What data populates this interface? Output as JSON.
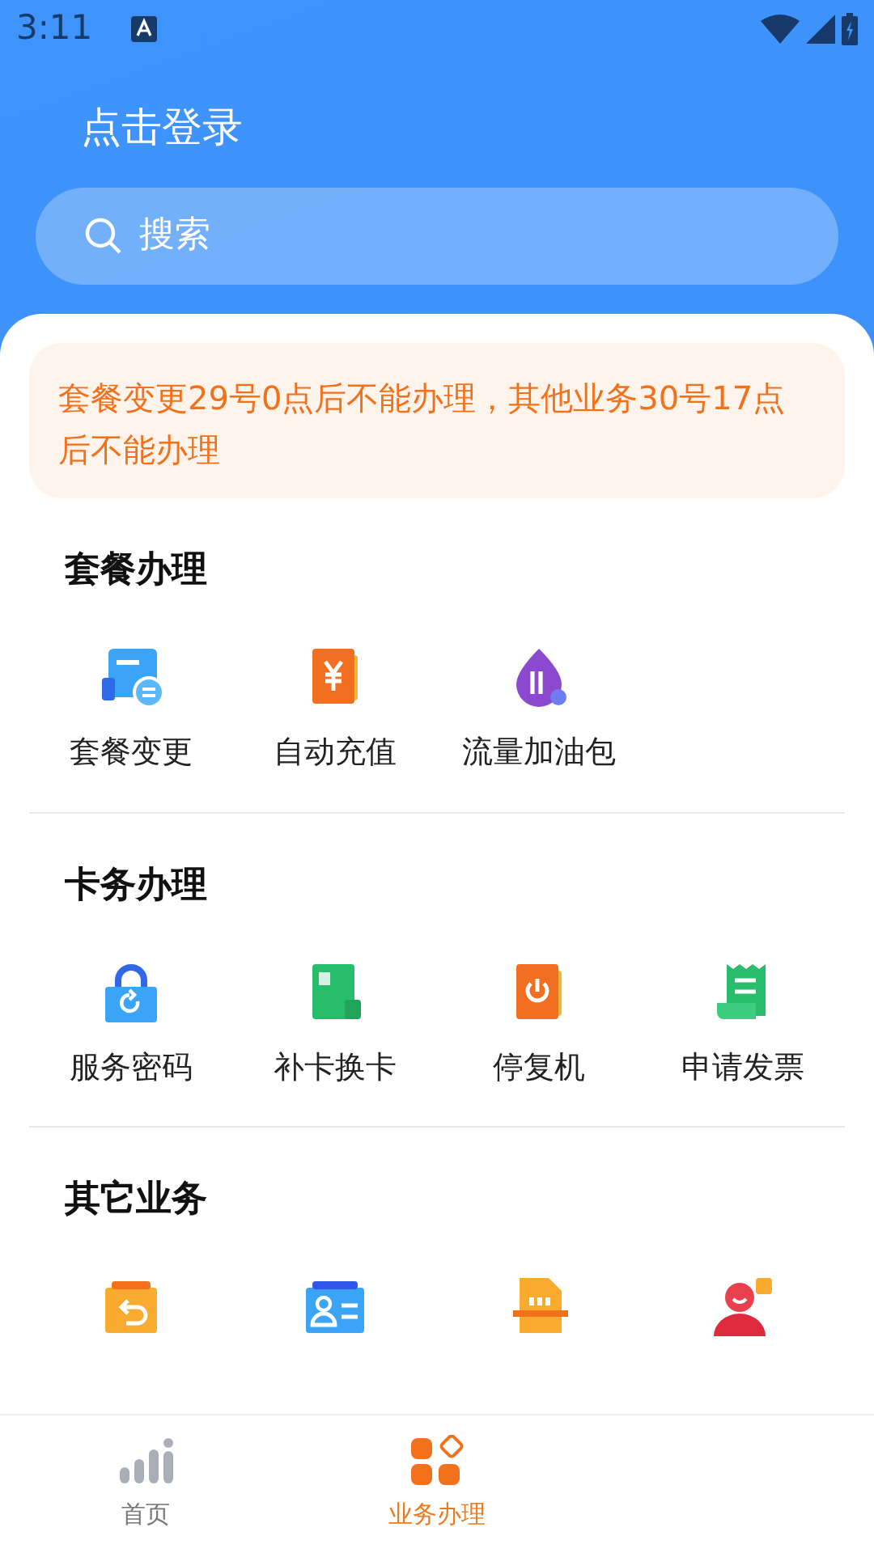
{
  "status_bar": {
    "time": "3:11"
  },
  "header": {
    "login": "点击登录",
    "search": {
      "placeholder": "搜索"
    }
  },
  "notice": "套餐变更29号0点后不能办理，其他业务30号17点后不能办理",
  "sections": [
    {
      "title": "套餐办理",
      "items": [
        {
          "kind": "plan",
          "label": "套餐变更"
        },
        {
          "kind": "recharge",
          "label": "自动充值"
        },
        {
          "kind": "data",
          "label": "流量加油包"
        }
      ]
    },
    {
      "title": "卡务办理",
      "items": [
        {
          "kind": "lock",
          "label": "服务密码"
        },
        {
          "kind": "sim",
          "label": "补卡换卡"
        },
        {
          "kind": "power",
          "label": "停复机"
        },
        {
          "kind": "invoice",
          "label": "申请发票"
        }
      ]
    },
    {
      "title": "其它业务",
      "items": [
        {
          "kind": "folder"
        },
        {
          "kind": "idcard"
        },
        {
          "kind": "chip"
        },
        {
          "kind": "person"
        }
      ]
    }
  ],
  "bottom_nav": [
    {
      "kind": "home",
      "label": "首页",
      "selected": false
    },
    {
      "kind": "business",
      "label": "业务办理",
      "selected": true
    }
  ]
}
